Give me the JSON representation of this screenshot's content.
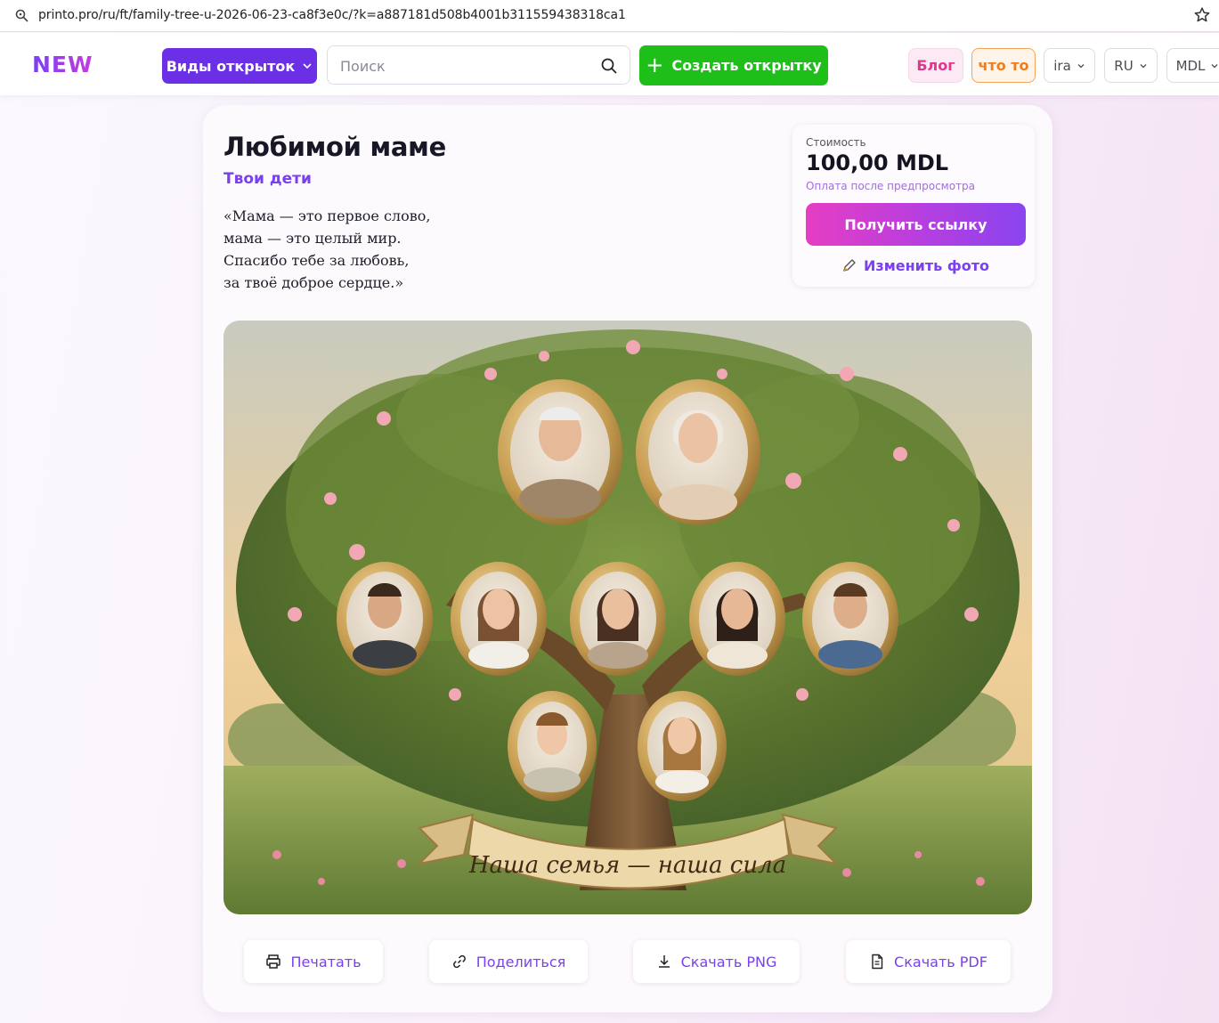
{
  "browser": {
    "url": "printo.pro/ru/ft/family-tree-u-2026-06-23-ca8f3e0c/?k=a887181d508b4001b311559438318ca1"
  },
  "header": {
    "logo": "NEW",
    "types_button": "Виды открыток",
    "search_placeholder": "Поиск",
    "create_button": "Создать открытку",
    "blog": "Блог",
    "chto_to": "что то",
    "user": "ira",
    "language": "RU",
    "currency": "MDL"
  },
  "card": {
    "title": "Любимой маме",
    "subtitle": "Твои дети",
    "poem": [
      "«Мама — это первое слово,",
      "мама — это целый мир.",
      "Спасибо тебе за любовь,",
      "за твоё доброе сердце.»"
    ],
    "price": {
      "label": "Стоимость",
      "value": "100,00 MDL",
      "note": "Оплата после предпросмотра",
      "get_link_button": "Получить ссылку",
      "edit_photo_button": "Изменить фото"
    },
    "artwork": {
      "banner_text": "Наша семья — наша сила",
      "description": "family tree with portraits"
    },
    "actions": {
      "print": "Печатать",
      "share": "Поделиться",
      "download_png": "Скачать PNG",
      "download_pdf": "Скачать PDF"
    }
  },
  "colors": {
    "accent": "#7b3ff2",
    "create_green": "#1fbf1a",
    "blog_pink": "#e0368e",
    "chto_orange": "#f07d1a"
  }
}
